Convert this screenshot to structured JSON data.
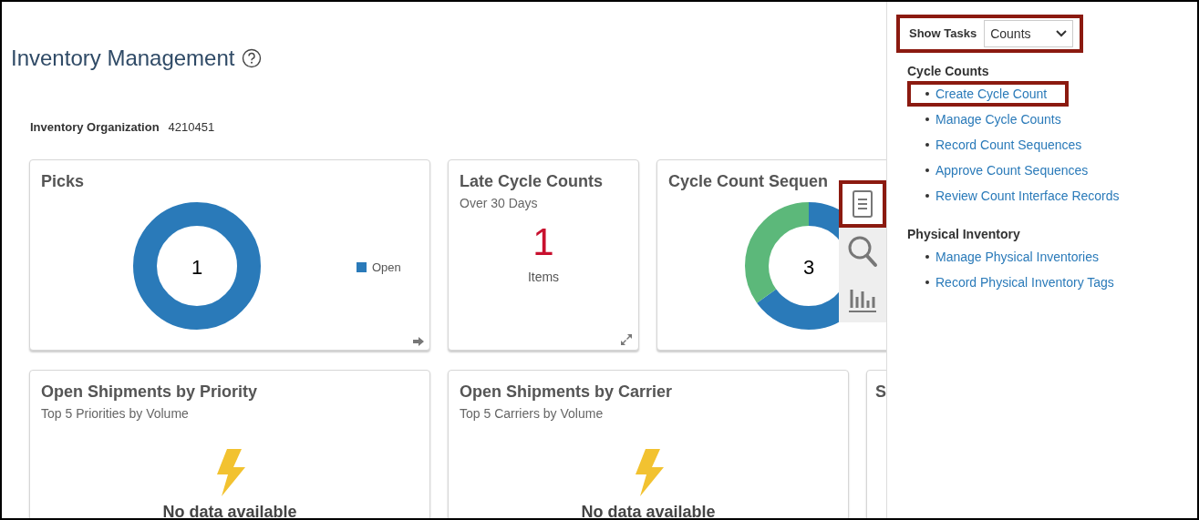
{
  "page": {
    "title": "Inventory Management"
  },
  "organization": {
    "label": "Inventory Organization",
    "value": "4210451"
  },
  "tiles": [
    {
      "kind": "donut",
      "title": "Picks",
      "center_value": "1",
      "legend": [
        {
          "label": "Open",
          "color": "#2a7ab9"
        }
      ]
    },
    {
      "kind": "metric",
      "title": "Late Cycle Counts",
      "subtitle": "Over 30 Days",
      "value": "1",
      "unit": "Items"
    },
    {
      "kind": "donut_split",
      "title": "Cycle Count Sequen",
      "center_value": "3"
    },
    {
      "kind": "nodata",
      "title": "Open Shipments by Priority",
      "subtitle": "Top 5 Priorities by Volume",
      "message": "No data available"
    },
    {
      "kind": "nodata",
      "title": "Open Shipments by Carrier",
      "subtitle": "Top 5 Carriers by Volume",
      "message": "No data available"
    },
    {
      "kind": "partial",
      "title": "S"
    }
  ],
  "tile_toolbar": [
    {
      "kind": "list",
      "selected": true,
      "highlighted": true
    },
    {
      "kind": "search",
      "selected": false,
      "highlighted": false
    },
    {
      "kind": "chart",
      "selected": false,
      "highlighted": false
    }
  ],
  "task_panel": {
    "label": "Show Tasks",
    "select_value": "Counts",
    "highlighted": true,
    "groups": [
      {
        "heading": "Cycle Counts",
        "items": [
          {
            "label": "Create Cycle Count",
            "highlighted": true
          },
          {
            "label": "Manage Cycle Counts",
            "highlighted": false
          },
          {
            "label": "Record Count Sequences",
            "highlighted": false
          },
          {
            "label": "Approve Count Sequences",
            "highlighted": false
          },
          {
            "label": "Review Count Interface Records",
            "highlighted": false
          }
        ]
      },
      {
        "heading": "Physical Inventory",
        "items": [
          {
            "label": "Manage Physical Inventories",
            "highlighted": false
          },
          {
            "label": "Record Physical Inventory Tags",
            "highlighted": false
          }
        ]
      }
    ]
  }
}
